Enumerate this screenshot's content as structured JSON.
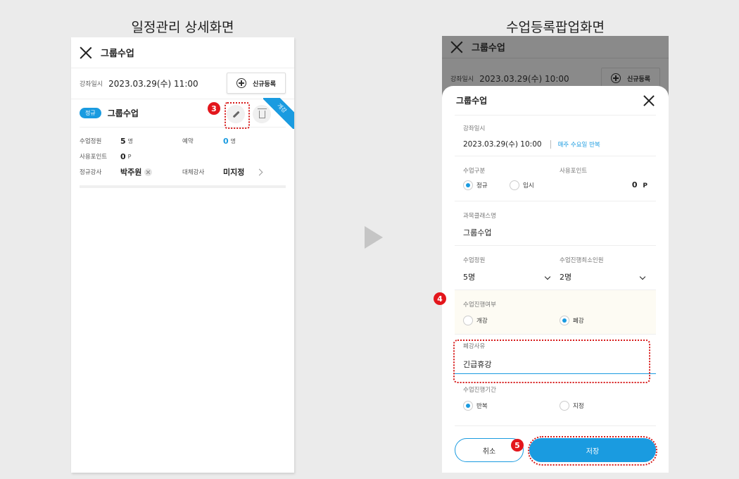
{
  "captions": {
    "left": "일정관리 상세화면",
    "right": "수업등록팝업화면"
  },
  "left": {
    "title": "그룹수업",
    "date_label": "강좌일시",
    "date_value": "2023.03.29(수) 11:00",
    "new_button": "신규등록",
    "badge": "정규",
    "class_name": "그룹수업",
    "ribbon": "개강",
    "step_badge": "3",
    "rows": [
      {
        "label": "수업정원",
        "value": "5",
        "unit": "명",
        "label2": "예약",
        "value2": "0",
        "unit2": "명"
      },
      {
        "label": "사용포인트",
        "value": "0",
        "unit": "P"
      },
      {
        "label": "정규강사",
        "value": "박주원",
        "label2": "대체강사",
        "value2": "미지정"
      }
    ]
  },
  "right": {
    "bg_title": "그룹수업",
    "bg_date_label": "강좌일시",
    "bg_date_value": "2023.03.29(수) 10:00",
    "bg_new_button": "신규등록",
    "modal": {
      "title": "그룹수업",
      "date_label": "강좌일시",
      "date_value": "2023.03.29(수) 10:00",
      "repeat_text": "매주 수요일 반복",
      "type_label": "수업구분",
      "type_regular": "정규",
      "type_temp": "임시",
      "type_selected": "정규",
      "points_label": "사용포인트",
      "points_value": "0",
      "points_unit": "P",
      "subject_label": "과목클래스명",
      "subject_value": "그룹수업",
      "capacity_label": "수업정원",
      "capacity_value": "5명",
      "min_label": "수업진행최소인원",
      "min_value": "2명",
      "status_label": "수업진행여부",
      "status_open": "개강",
      "status_closed": "폐강",
      "status_selected": "폐강",
      "reason_label": "폐강사유",
      "reason_value": "긴급휴강",
      "period_label": "수업진행기간",
      "period_repeat": "반복",
      "period_fixed": "지정",
      "period_selected": "반복",
      "cancel_button": "취소",
      "save_button": "저장",
      "step4": "4",
      "step5": "5"
    }
  },
  "colors": {
    "accent": "#1a9be0",
    "highlight": "#d71a1a",
    "overlay": "#8a8a8a"
  }
}
